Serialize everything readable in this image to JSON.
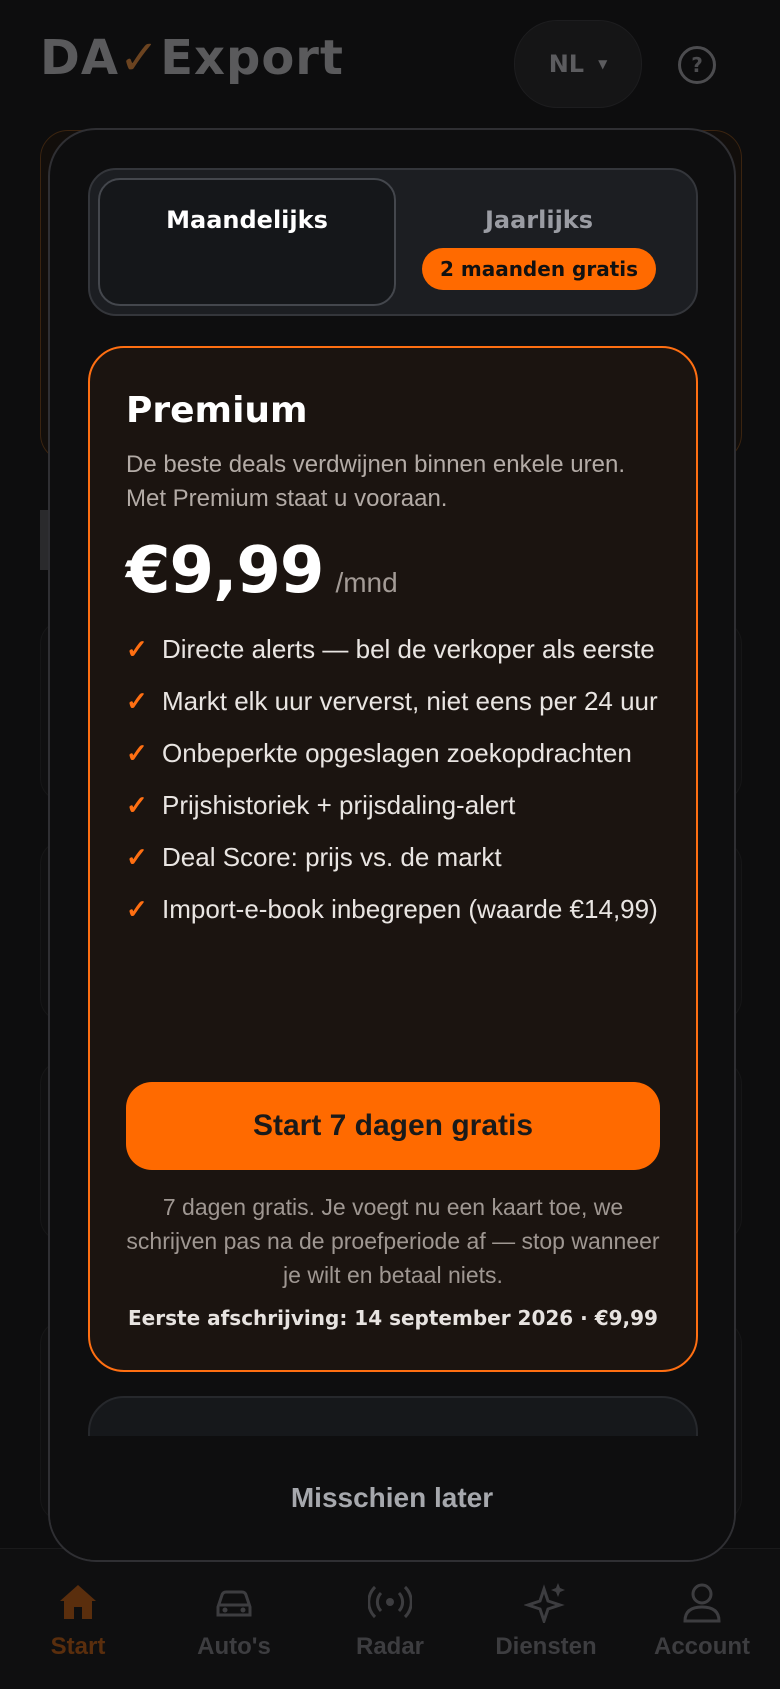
{
  "app": {
    "logo_prefix": "DA",
    "logo_check": "✓",
    "logo_suffix": "Export",
    "language": "NL",
    "help_icon": "?"
  },
  "toggle": {
    "monthly_label": "Maandelijks",
    "yearly_label": "Jaarlijks",
    "yearly_badge": "2 maanden gratis",
    "selected": "monthly"
  },
  "plan": {
    "title": "Premium",
    "description": "De beste deals verdwijnen binnen enkele uren. Met Premium staat u vooraan.",
    "price": "€9,99",
    "period": "/mnd",
    "features": [
      "Directe alerts — bel de verkoper als eerste",
      "Markt elk uur ververst, niet eens per 24 uur",
      "Onbeperkte opgeslagen zoekopdrachten",
      "Prijshistoriek + prijsdaling-alert",
      "Deal Score: prijs vs. de markt",
      "Import-e-book inbegrepen (waarde €14,99)"
    ],
    "cta": "Start 7 dagen gratis",
    "trial_note": "7 dagen gratis. Je voegt nu een kaart toe, we schrijven pas na de proefperiode af — stop wanneer je wilt en betaal niets.",
    "first_charge": "Eerste afschrijving: 14 september 2026 · €9,99"
  },
  "later_button": "Misschien later",
  "bottom_nav": [
    {
      "label": "Start",
      "icon": "home-icon",
      "active": true
    },
    {
      "label": "Auto's",
      "icon": "car-icon",
      "active": false
    },
    {
      "label": "Radar",
      "icon": "radar-icon",
      "active": false
    },
    {
      "label": "Diensten",
      "icon": "sparkles-icon",
      "active": false
    },
    {
      "label": "Account",
      "icon": "user-icon",
      "active": false
    }
  ],
  "colors": {
    "accent": "#ff6a00",
    "background": "#0d0d0e",
    "card": "#1b1410"
  }
}
